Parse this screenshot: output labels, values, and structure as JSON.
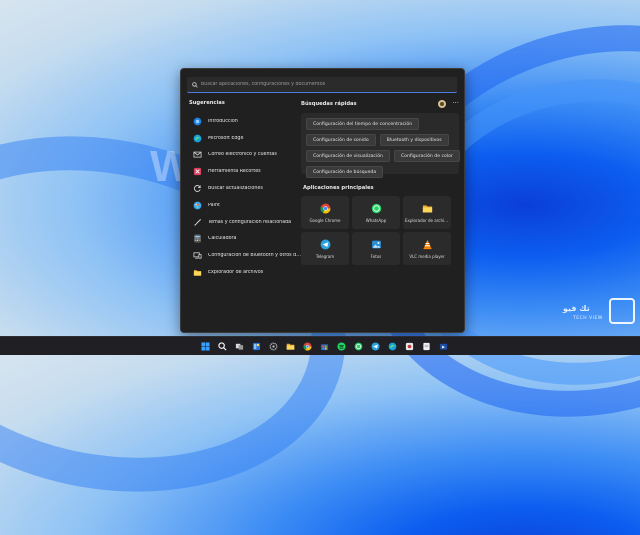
{
  "search": {
    "placeholder": "Buscar aplicaciones, configuraciones y documentos"
  },
  "suggestions": {
    "title": "Sugerencias",
    "items": [
      {
        "label": "Introducción",
        "icon": "intro-icon",
        "color": "#4aa3ff"
      },
      {
        "label": "Microsoft Edge",
        "icon": "edge-icon",
        "color": "#2aa8e0"
      },
      {
        "label": "Correo electrónico y cuentas",
        "icon": "mail-icon",
        "color": "#cfcfcf"
      },
      {
        "label": "Herramienta Recortes",
        "icon": "snipping-tool-icon",
        "color": "#e04b64"
      },
      {
        "label": "Buscar actualizaciones",
        "icon": "refresh-icon",
        "color": "#cfcfcf"
      },
      {
        "label": "Paint",
        "icon": "paint-icon",
        "color": "#6cc7ff"
      },
      {
        "label": "Temas y configuración relacionada",
        "icon": "brush-icon",
        "color": "#cfcfcf"
      },
      {
        "label": "Calculadora",
        "icon": "calculator-icon",
        "color": "#5a5a5a"
      },
      {
        "label": "Configuración de Bluetooth y otros dispositivos",
        "icon": "devices-icon",
        "color": "#cfcfcf"
      },
      {
        "label": "Explorador de archivos",
        "icon": "folder-icon",
        "color": "#f5c242"
      }
    ]
  },
  "quick": {
    "title": "Búsquedas rápidas",
    "rows": [
      [
        "Configuración del tiempo de concentración"
      ],
      [
        "Configuración de sonido",
        "Bluetooth y dispositivos"
      ],
      [
        "Configuración de visualización",
        "Configuración de color"
      ],
      [
        "Configuración de búsqueda"
      ]
    ]
  },
  "apps": {
    "title": "Aplicaciones principales",
    "items": [
      {
        "label": "Google Chrome",
        "icon": "chrome-icon"
      },
      {
        "label": "WhatsApp",
        "icon": "whatsapp-icon"
      },
      {
        "label": "Explorador de archivos",
        "icon": "folder-icon"
      },
      {
        "label": "Telegram",
        "icon": "telegram-icon"
      },
      {
        "label": "Fotos",
        "icon": "photos-icon"
      },
      {
        "label": "VLC media player",
        "icon": "vlc-icon"
      }
    ]
  },
  "taskbar": {
    "icons": [
      "start-icon",
      "search-icon",
      "task-view-icon",
      "widgets-icon",
      "settings-icon",
      "file-explorer-icon",
      "chrome-icon",
      "store-icon",
      "spotify-icon",
      "whatsapp-icon",
      "telegram-icon",
      "edge-icon",
      "app-icon",
      "notes-icon",
      "folder-icon"
    ]
  },
  "watermark": {
    "text": "تك فيو",
    "sub": "TECH VIEW"
  }
}
